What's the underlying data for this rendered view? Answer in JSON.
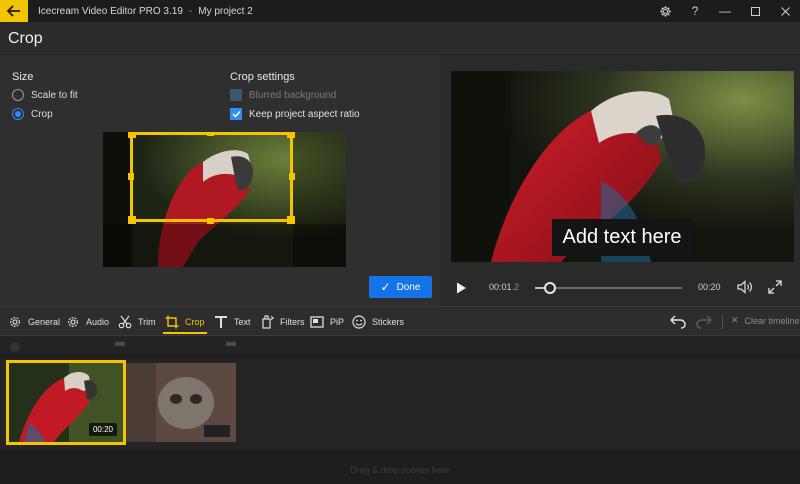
{
  "titlebar": {
    "app_name": "Icecream Video Editor PRO 3.19",
    "separator": "-",
    "project_name": "My project 2",
    "icons": [
      "back-arrow-icon",
      "gear-icon",
      "help-icon",
      "minimize-icon",
      "maximize-icon",
      "close-icon"
    ]
  },
  "header": {
    "title": "Crop"
  },
  "size_section": {
    "heading": "Size",
    "options": [
      {
        "label": "Scale to fit",
        "selected": false
      },
      {
        "label": "Crop",
        "selected": true
      }
    ]
  },
  "crop_settings": {
    "heading": "Crop settings",
    "blurred_background": {
      "label": "Blurred background",
      "checked": false,
      "enabled": false
    },
    "keep_aspect": {
      "label": "Keep project aspect ratio",
      "checked": true,
      "enabled": true
    }
  },
  "done_button": {
    "label": "Done"
  },
  "preview": {
    "overlay_text": "Add text here",
    "current_time": "00:01",
    "current_time_fraction": ".2",
    "end_time": "00:20",
    "seek_fraction": 0.1
  },
  "toolbar": {
    "tools": [
      {
        "label": "General",
        "icon": "gear-icon"
      },
      {
        "label": "Audio",
        "icon": "gear-icon"
      },
      {
        "label": "Trim",
        "icon": "scissors-icon"
      },
      {
        "label": "Crop",
        "icon": "crop-icon",
        "active": true
      },
      {
        "label": "Text",
        "icon": "text-icon"
      },
      {
        "label": "Filters",
        "icon": "filters-icon"
      },
      {
        "label": "PiP",
        "icon": "pip-icon"
      },
      {
        "label": "Stickers",
        "icon": "sticker-icon"
      }
    ],
    "clear_timeline": "Clear timeline"
  },
  "timeline": {
    "clips": [
      {
        "duration": "00:20",
        "selected": true
      },
      {
        "duration": "",
        "selected": false
      }
    ],
    "dropzone_text": "Drag & drop scenes here"
  },
  "colors": {
    "accent": "#f2c500",
    "primary_button": "#1473e6",
    "checkbox": "#2b8ff0"
  }
}
